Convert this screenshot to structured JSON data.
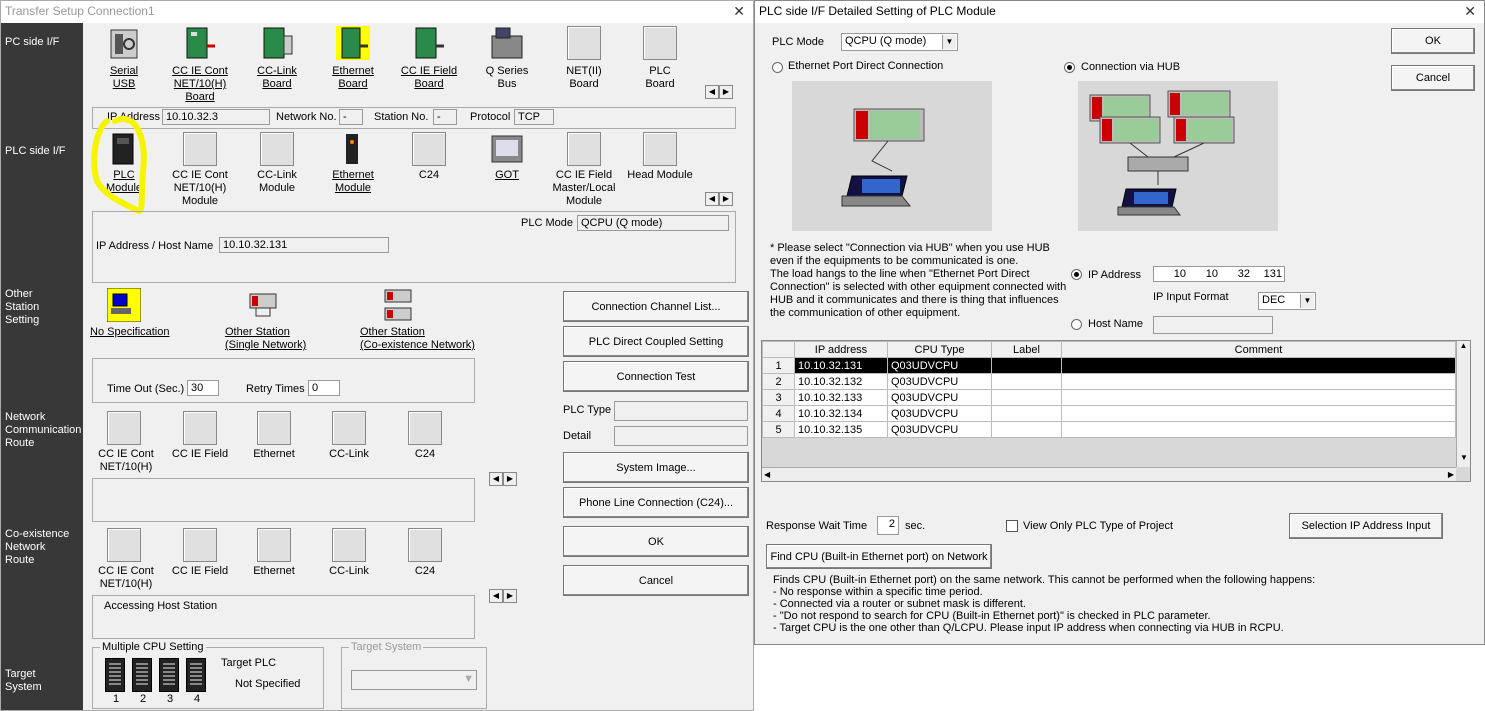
{
  "left": {
    "title": "Transfer Setup Connection1",
    "sidebar": {
      "pc_if": "PC side I/F",
      "plc_if": "PLC side I/F",
      "other_station": "Other\nStation\nSetting",
      "network_route": "Network\nCommunication\nRoute",
      "coexistence": "Co-existence\nNetwork\nRoute",
      "target": "Target\nSystem"
    },
    "pc_icons": [
      "Serial\nUSB",
      "CC IE Cont\nNET/10(H)\nBoard",
      "CC-Link\nBoard",
      "Ethernet\nBoard",
      "CC IE Field\nBoard",
      "Q Series\nBus",
      "NET(II)\nBoard",
      "PLC\nBoard"
    ],
    "pc_row": {
      "ip_label": "IP Address",
      "ip_value": "10.10.32.3",
      "network_label": "Network No.",
      "network_value": "-",
      "station_label": "Station No.",
      "station_value": "-",
      "protocol_label": "Protocol",
      "protocol_value": "TCP"
    },
    "plc_icons": [
      "PLC\nModule",
      "CC IE Cont\nNET/10(H)\nModule",
      "CC-Link\nModule",
      "Ethernet\nModule",
      "C24",
      "GOT",
      "CC IE Field\nMaster/Local\nModule",
      "Head Module"
    ],
    "plc_row": {
      "plc_mode_label": "PLC Mode",
      "plc_mode_value": "QCPU (Q mode)",
      "ip_host_label": "IP Address / Host Name",
      "ip_host_value": "10.10.32.131"
    },
    "other_icons": [
      "No Specification",
      "Other Station\n(Single Network)",
      "Other Station\n(Co-existence Network)"
    ],
    "timeout_label": "Time Out (Sec.)",
    "timeout_value": "30",
    "retry_label": "Retry Times",
    "retry_value": "0",
    "route_icons": [
      "CC IE Cont\nNET/10(H)",
      "CC IE Field",
      "Ethernet",
      "CC-Link",
      "C24"
    ],
    "coex_icons": [
      "CC IE Cont\nNET/10(H)",
      "CC IE Field",
      "Ethernet",
      "CC-Link",
      "C24"
    ],
    "accessing": "Accessing Host Station",
    "multi_cpu_label": "Multiple CPU Setting",
    "target_plc_label": "Target PLC",
    "target_plc_value": "Not Specified",
    "cpu_numbers": [
      "1",
      "2",
      "3",
      "4"
    ],
    "target_system_label": "Target System",
    "buttons": {
      "channel_list": "Connection Channel List...",
      "direct_coupled": "PLC Direct Coupled Setting",
      "connection_test": "Connection Test",
      "system_image": "System Image...",
      "phone_line": "Phone Line Connection (C24)...",
      "ok": "OK",
      "cancel": "Cancel"
    },
    "plc_type_label": "PLC Type",
    "detail_label": "Detail"
  },
  "right": {
    "title": "PLC side I/F Detailed Setting of PLC Module",
    "plc_mode_label": "PLC Mode",
    "plc_mode_value": "QCPU (Q mode)",
    "ok": "OK",
    "cancel": "Cancel",
    "radio_direct": "Ethernet Port Direct Connection",
    "radio_hub": "Connection via HUB",
    "note": "* Please select \"Connection via HUB\" when you use HUB\neven if the equipments to be communicated is one.\nThe load hangs to the line when \"Ethernet Port Direct\nConnection\" is selected with other equipment connected with\nHUB and it communicates and there is thing that influences\nthe communication of other equipment.",
    "ip_label": "IP Address",
    "ip_octets": [
      "10",
      "10",
      "32",
      "131"
    ],
    "ip_format_label": "IP Input Format",
    "ip_format_value": "DEC",
    "host_label": "Host Name",
    "table": {
      "headers": [
        "IP address",
        "CPU Type",
        "Label",
        "Comment"
      ],
      "rows": [
        {
          "n": "1",
          "ip": "10.10.32.131",
          "cpu": "Q03UDVCPU"
        },
        {
          "n": "2",
          "ip": "10.10.32.132",
          "cpu": "Q03UDVCPU"
        },
        {
          "n": "3",
          "ip": "10.10.32.133",
          "cpu": "Q03UDVCPU"
        },
        {
          "n": "4",
          "ip": "10.10.32.134",
          "cpu": "Q03UDVCPU"
        },
        {
          "n": "5",
          "ip": "10.10.32.135",
          "cpu": "Q03UDVCPU"
        }
      ]
    },
    "response_label": "Response Wait Time",
    "response_value": "2",
    "response_unit": "sec.",
    "view_only_label": "View Only PLC Type of Project",
    "selection_ip_button": "Selection IP Address Input",
    "find_cpu_button": "Find CPU (Built-in Ethernet port) on Network",
    "find_desc": "Finds CPU (Built-in Ethernet port) on the same network. This cannot be performed when the following happens:\n- No response within a specific time period.\n- Connected via a router or subnet mask is different.\n- \"Do not respond to search for CPU (Built-in Ethernet port)\" is checked in PLC parameter.\n- Target CPU is the one other than Q/LCPU. Please input IP address when connecting via HUB in RCPU."
  },
  "colors": {
    "sidebar": "#383838",
    "highlight": "#f5f500",
    "selected_row": "#000000"
  }
}
